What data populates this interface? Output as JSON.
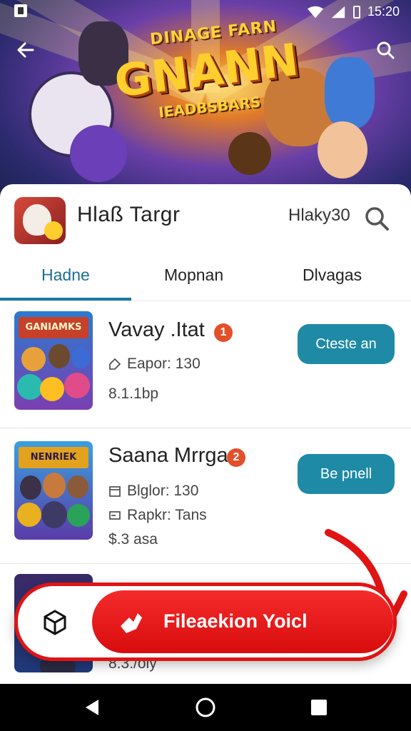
{
  "status": {
    "time": "15:20"
  },
  "hero": {
    "title_top": "DINAGE FARN",
    "title": "GNANN",
    "title_sub": "IEADBSBARS"
  },
  "app": {
    "name": "Hlaß Targr",
    "meta": "Hlaky30"
  },
  "tabs": [
    {
      "label": "Hadne",
      "active": true
    },
    {
      "label": "Mopnan",
      "active": false
    },
    {
      "label": "Dlvagas",
      "active": false
    }
  ],
  "items": [
    {
      "title": "Vavay .Itat",
      "badge": "1",
      "thumb_banner": "GANIAMKS",
      "meta1": "Eapor: 130",
      "meta2": "",
      "price": "8.1.1bp",
      "button": "Cteste an"
    },
    {
      "title": "Saana Mrrga",
      "badge": "2",
      "thumb_banner": "NENRIEK",
      "meta1": "Blglor: 130",
      "meta2": "Rapkr: Tans",
      "price": "$.3 asa",
      "button": "Be pnell"
    },
    {
      "title": "",
      "badge": "",
      "thumb_banner": "",
      "meta1": "",
      "meta2": "",
      "price": "8.3./oly",
      "button": ""
    }
  ],
  "fab": {
    "label": "Fileaekion Yoicl"
  },
  "colors": {
    "accent": "#1e8aa6",
    "fab_red": "#e01414",
    "tab_active": "#1c6f92"
  },
  "icons": {
    "back": "arrow-left-icon",
    "search": "search-icon",
    "nav_back": "triangle-back-icon",
    "nav_home": "circle-home-icon",
    "nav_recents": "square-recents-icon"
  }
}
